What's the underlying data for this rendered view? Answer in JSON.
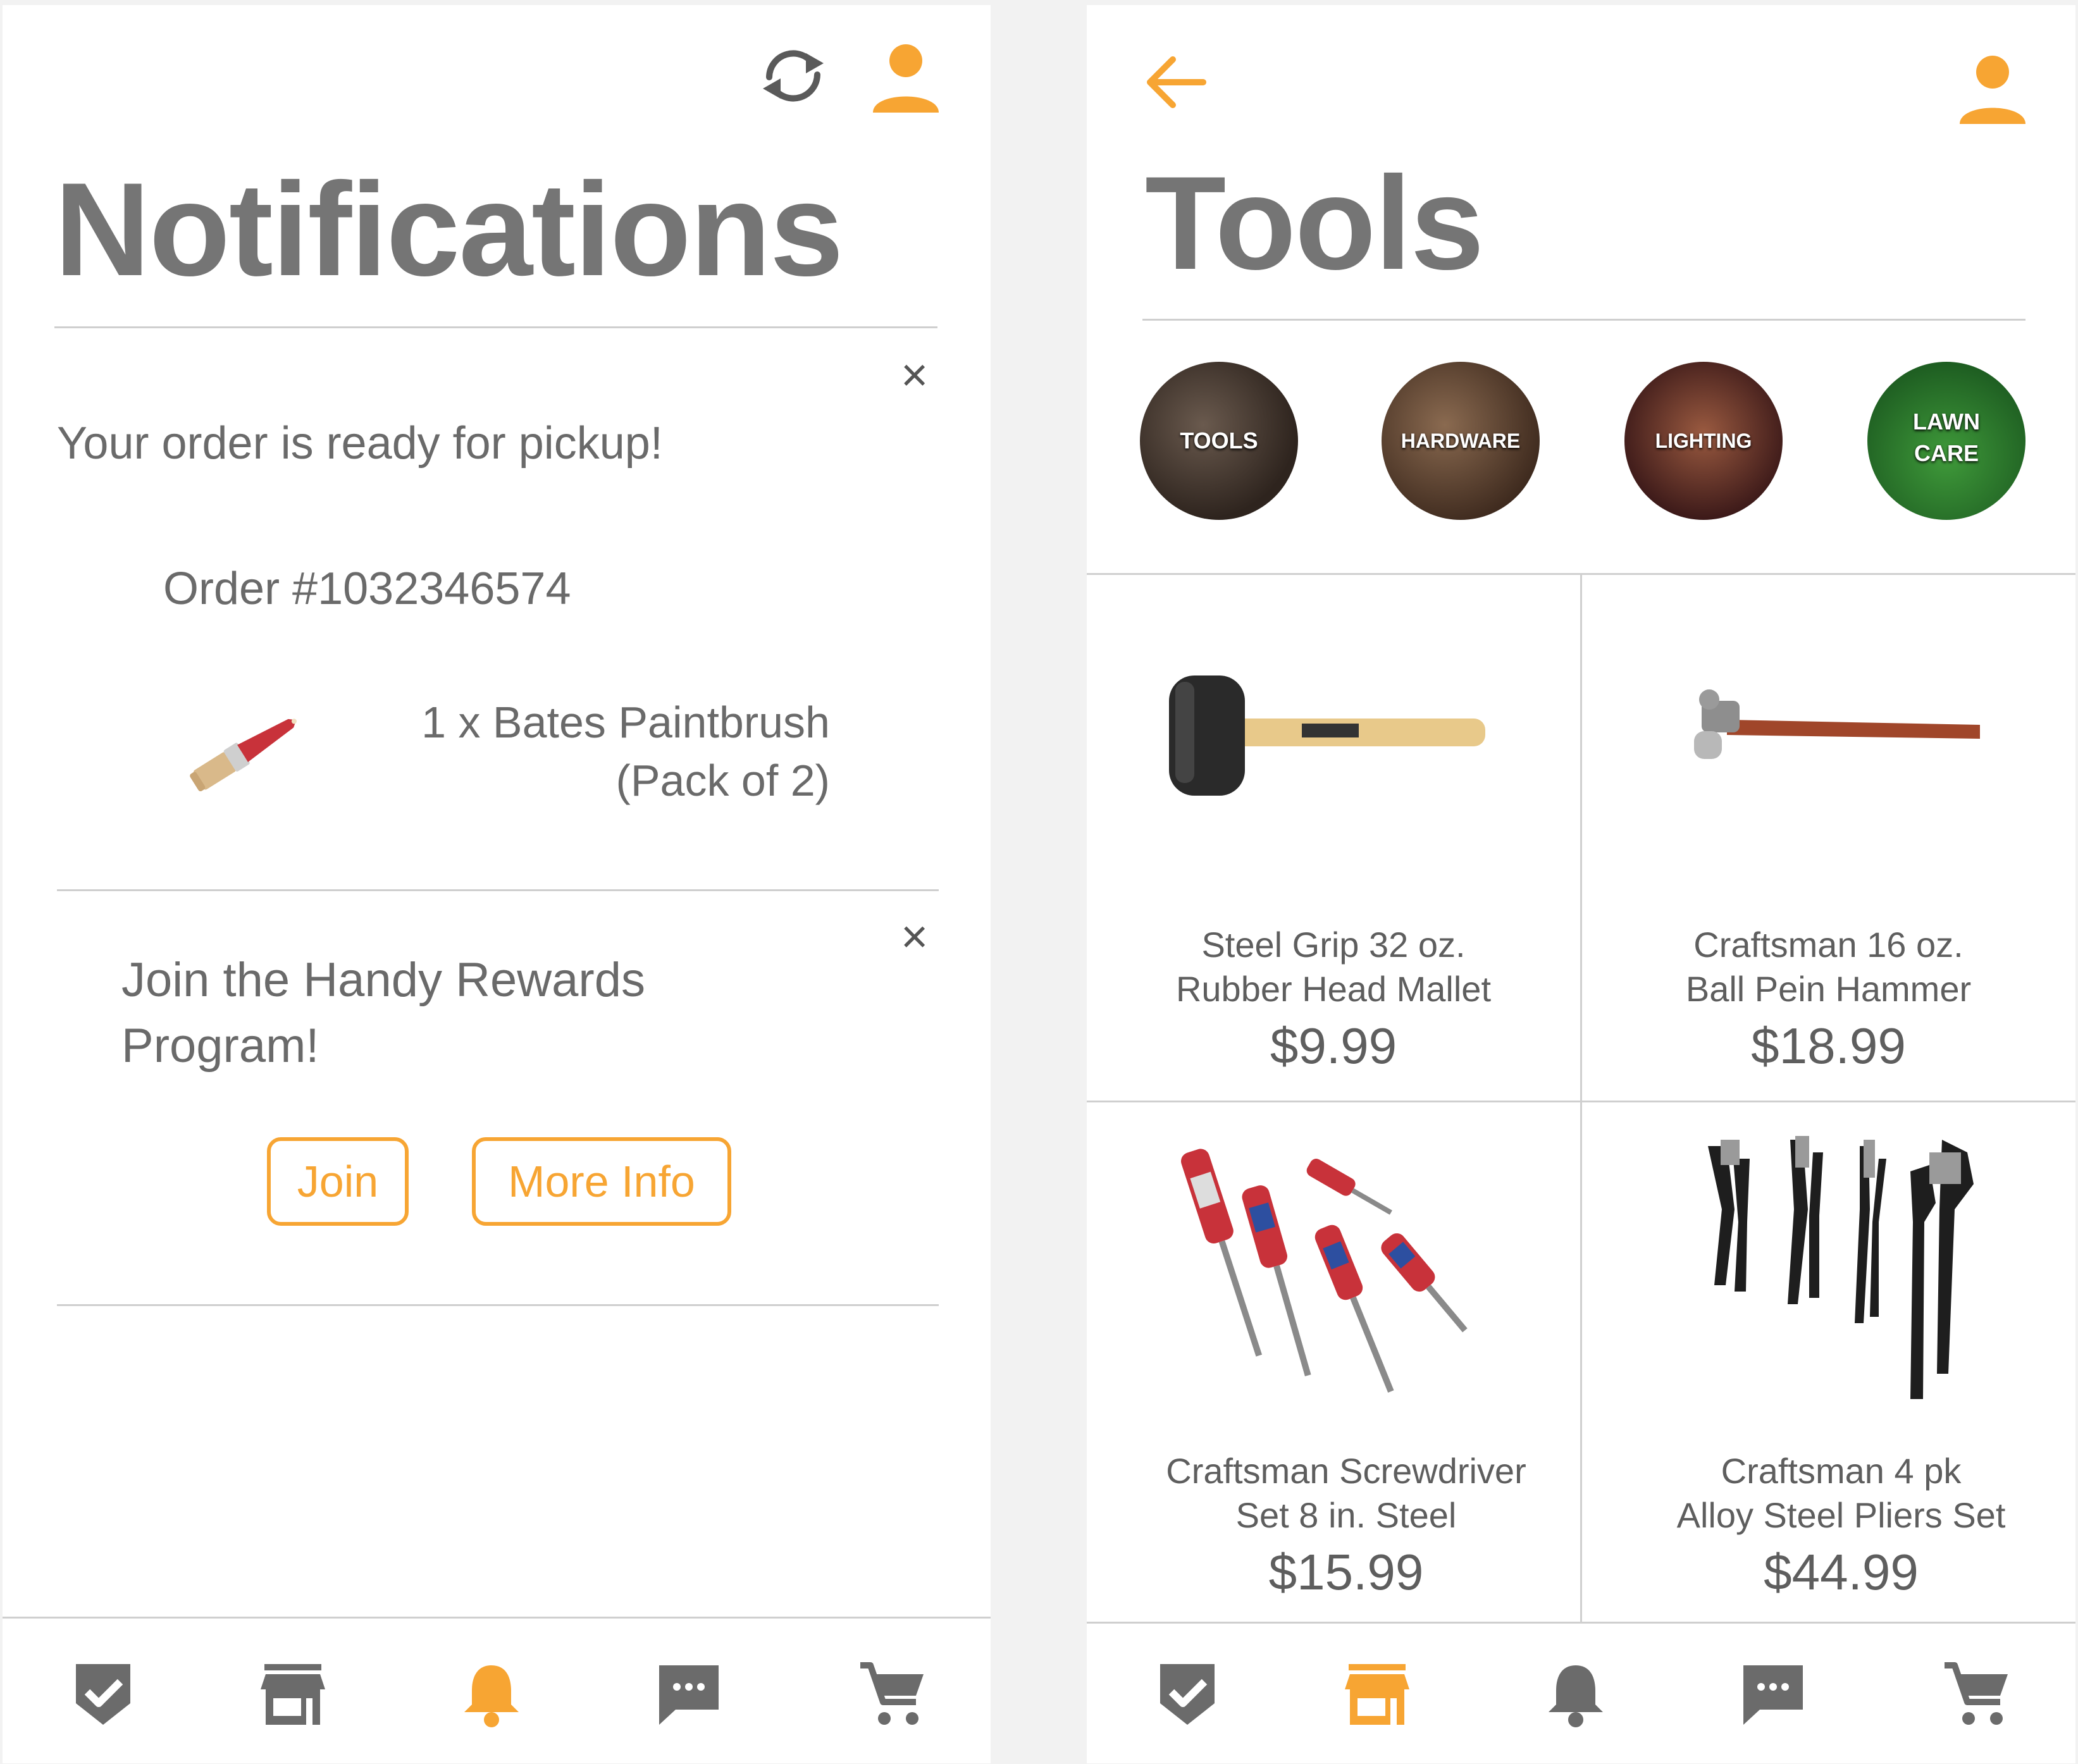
{
  "notifications_screen": {
    "title": "Notifications",
    "header_icons": [
      "refresh-icon",
      "user-icon"
    ],
    "order_notification": {
      "message": "Your order is ready for pickup!",
      "order_number": "Order #1032346574",
      "item_line1": "1 x Bates Paintbrush",
      "item_line2": "(Pack of 2)",
      "close_label": "×"
    },
    "rewards_notification": {
      "message_line1": "Join the Handy Rewards",
      "message_line2": "Program!",
      "join_label": "Join",
      "more_info_label": "More Info",
      "close_label": "×"
    },
    "bottom_nav": {
      "items": [
        "badge-check-icon",
        "store-icon",
        "bell-icon",
        "chat-icon",
        "cart-icon"
      ],
      "active": "bell-icon"
    }
  },
  "tools_screen": {
    "title": "Tools",
    "header_icons": [
      "back-arrow-icon",
      "user-icon"
    ],
    "categories": [
      {
        "label": "TOOLS",
        "label2": ""
      },
      {
        "label": "HARDWARE",
        "label2": ""
      },
      {
        "label": "LIGHTING",
        "label2": ""
      },
      {
        "label": "LAWN",
        "label2": "CARE"
      }
    ],
    "products": [
      {
        "name_line1": "Steel Grip 32 oz.",
        "name_line2": "Rubber Head Mallet",
        "price": "$9.99"
      },
      {
        "name_line1": "Craftsman 16 oz.",
        "name_line2": "Ball Pein Hammer",
        "price": "$18.99"
      },
      {
        "name_line1": "Craftsman Screwdriver",
        "name_line2": "Set 8 in. Steel",
        "price": "$15.99"
      },
      {
        "name_line1": "Craftsman 4 pk",
        "name_line2": "Alloy Steel Pliers Set",
        "price": "$44.99"
      }
    ],
    "bottom_nav": {
      "items": [
        "badge-check-icon",
        "store-icon",
        "bell-icon",
        "chat-icon",
        "cart-icon"
      ],
      "active": "store-icon"
    }
  },
  "colors": {
    "accent": "#f7a533",
    "text": "#6d6d6d",
    "icon_gray": "#6b6b6b",
    "divider": "#cfcfcf"
  }
}
